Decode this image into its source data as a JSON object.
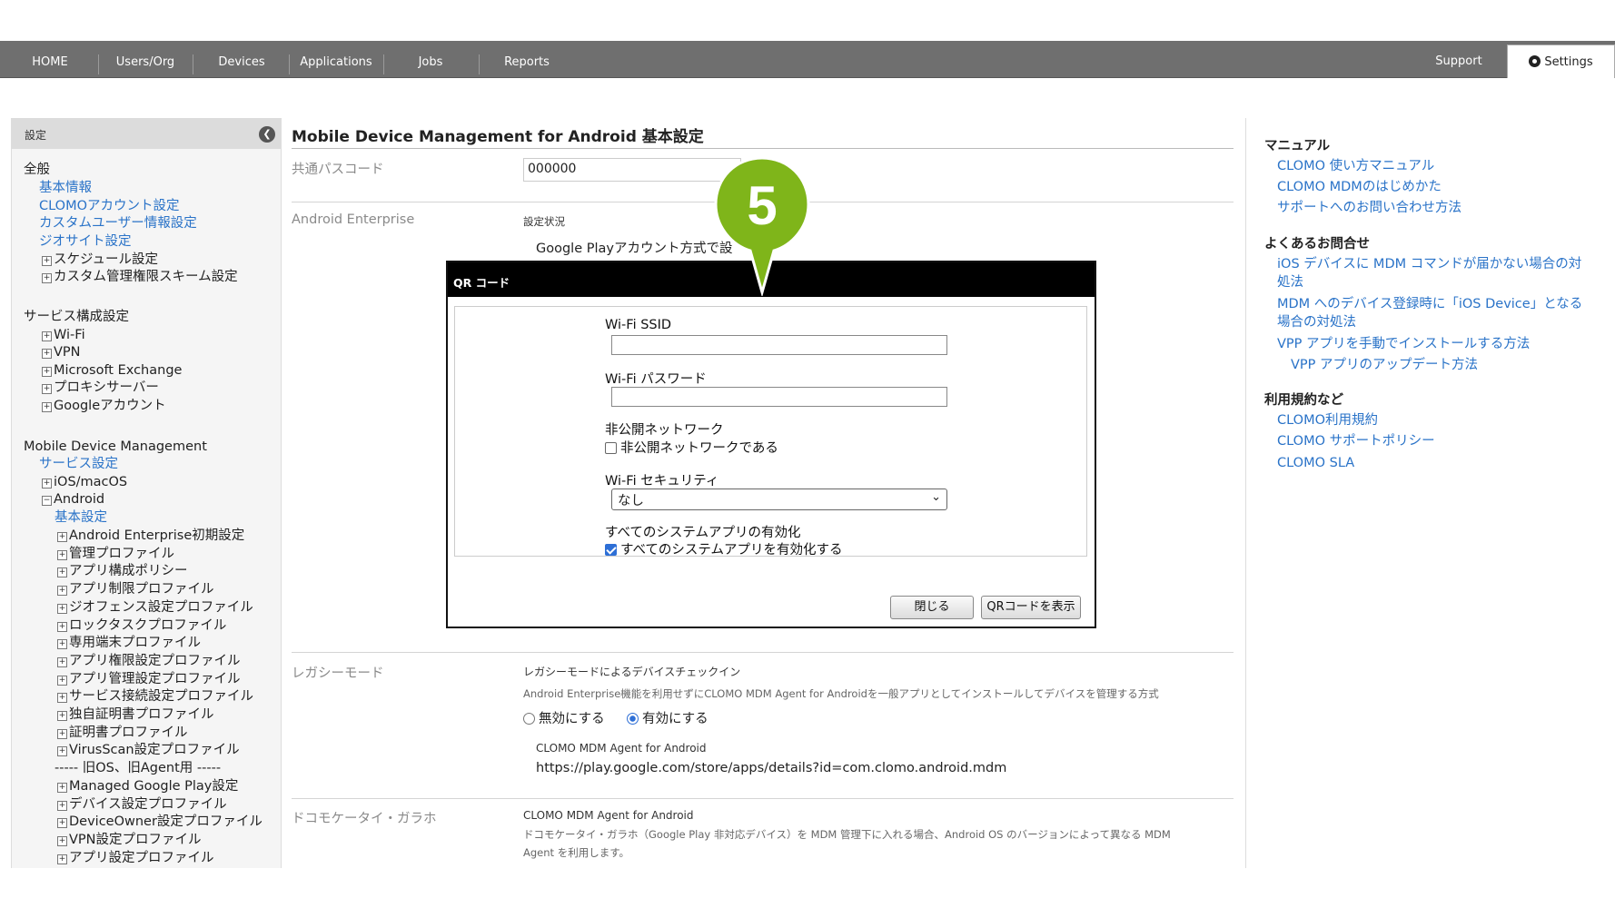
{
  "nav": {
    "items": [
      "HOME",
      "Users/Org",
      "Devices",
      "Applications",
      "Jobs",
      "Reports"
    ],
    "support": "Support",
    "settings": "Settings"
  },
  "sidebar": {
    "title": "設定",
    "collapse_icon": "chevron-left-circle-icon",
    "sections": {
      "general": "全般",
      "general_items": [
        "基本情報",
        "CLOMOアカウント設定",
        "カスタムユーザー情報設定",
        "ジオサイト設定"
      ],
      "general_expandables": [
        "スケジュール設定",
        "カスタム管理権限スキーム設定"
      ],
      "service": "サービス構成設定",
      "service_items": [
        "Wi-Fi",
        "VPN",
        "Microsoft Exchange",
        "プロキシサーバー",
        "Googleアカウント"
      ],
      "mdm": "Mobile Device Management",
      "mdm_service": "サービス設定",
      "ios": "iOS/macOS",
      "android": "Android",
      "android_basic": "基本設定",
      "android_items": [
        "Android Enterprise初期設定",
        "管理プロファイル",
        "アプリ構成ポリシー",
        "アプリ制限プロファイル",
        "ジオフェンス設定プロファイル",
        "ロックタスクプロファイル",
        "専用端末プロファイル",
        "アプリ権限設定プロファイル",
        "アプリ管理設定プロファイル",
        "サービス接続設定プロファイル",
        "独自証明書プロファイル",
        "証明書プロファイル",
        "VirusScan設定プロファイル"
      ],
      "legacy_divider": "----- 旧OS、旧Agent用 -----",
      "legacy_items": [
        "Managed Google Play設定",
        "デバイス設定プロファイル",
        "DeviceOwner設定プロファイル",
        "VPN設定プロファイル",
        "アプリ設定プロファイル"
      ]
    }
  },
  "main": {
    "title": "Mobile Device Management for Android 基本設定",
    "passcode_label": "共通パスコード",
    "passcode_value": "000000",
    "ae_label": "Android Enterprise",
    "ae_status_label": "設定状況",
    "ae_status_text": "Google Playアカウント方式で設",
    "legacy_label": "レガシーモード",
    "legacy_title": "レガシーモードによるデバイスチェックイン",
    "legacy_desc": "Android Enterprise機能を利用せずにCLOMO MDM Agent for Androidを一般アプリとしてインストールしてデバイスを管理する方式",
    "legacy_off": "無効にする",
    "legacy_on": "有効にする",
    "agent_label": "CLOMO MDM Agent for Android",
    "agent_url": "https://play.google.com/store/apps/details?id=com.clomo.android.mdm",
    "docomo_label": "ドコモケータイ・ガラホ",
    "docomo_title": "CLOMO MDM Agent for Android",
    "docomo_desc_1": "ドコモケータイ・ガラホ（Google Play 非対応デバイス）を MDM 管理下に入れる場合、Android OS のバージョンによって異なる MDM",
    "docomo_desc_2": "Agent を利用します。"
  },
  "right": {
    "manual_heading": "マニュアル",
    "manual_links": [
      "CLOMO 使い方マニュアル",
      "CLOMO MDMのはじめかた",
      "サポートへのお問い合わせ方法"
    ],
    "faq_heading": "よくあるお問合せ",
    "faq_1a": "iOS デバイスに MDM コマンドが届かない場合の対",
    "faq_1b": "処法",
    "faq_2a": "MDM へのデバイス登録時に「iOS Device」となる",
    "faq_2b": "場合の対処法",
    "faq_3": "VPP アプリを手動でインストールする方法",
    "faq_4": "VPP アプリのアップデート方法",
    "terms_heading": "利用規約など",
    "terms_links": [
      "CLOMO利用規約",
      "CLOMO サポートポリシー",
      "CLOMO SLA"
    ]
  },
  "modal": {
    "title": "QR コード",
    "ssid_label": "Wi-Fi SSID",
    "ssid_value": "",
    "password_label": "Wi-Fi パスワード",
    "password_value": "",
    "hidden_label": "非公開ネットワーク",
    "hidden_checkbox": "非公開ネットワークである",
    "hidden_checked": false,
    "security_label": "Wi-Fi セキュリティ",
    "security_value": "なし",
    "sysapps_label": "すべてのシステムアプリの有効化",
    "sysapps_checkbox": "すべてのシステムアプリを有効化する",
    "sysapps_checked": true,
    "close_button": "閉じる",
    "show_qr_button": "QRコードを表示"
  },
  "marker": {
    "number": "5",
    "color": "#7fb51a"
  }
}
